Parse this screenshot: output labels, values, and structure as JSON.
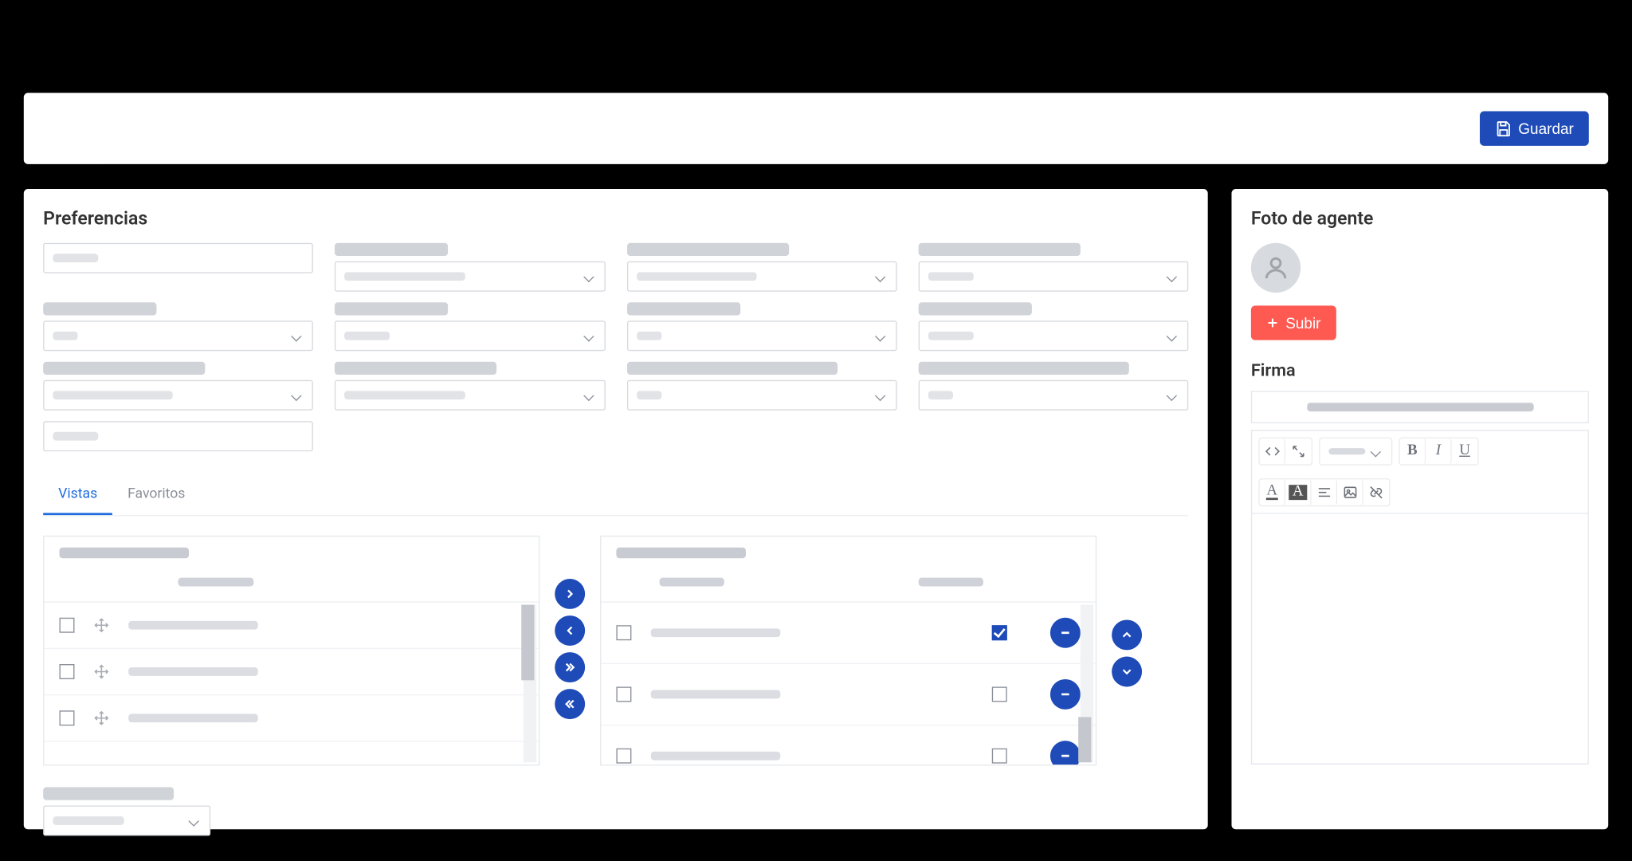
{
  "header": {
    "save_label": "Guardar"
  },
  "preferences": {
    "title": "Preferencias"
  },
  "tabs": {
    "views_label": "Vistas",
    "favorites_label": "Favoritos",
    "active": "views"
  },
  "transfer": {
    "buttons": {
      "right": "›",
      "left": "‹",
      "right_all": "»",
      "left_all": "«"
    },
    "order": {
      "up": "ˆ",
      "down": "ˇ"
    },
    "right_rows": [
      {
        "checked": false,
        "visible_checked": true
      },
      {
        "checked": false,
        "visible_checked": false
      },
      {
        "checked": false,
        "visible_checked": false
      }
    ]
  },
  "agent_photo": {
    "title": "Foto de agente",
    "upload_label": "Subir"
  },
  "signature": {
    "title": "Firma"
  },
  "editor": {
    "bold_mark": "B",
    "italic_mark": "I",
    "underline_mark": "U",
    "font_color_mark": "A",
    "bg_color_mark": "A"
  }
}
